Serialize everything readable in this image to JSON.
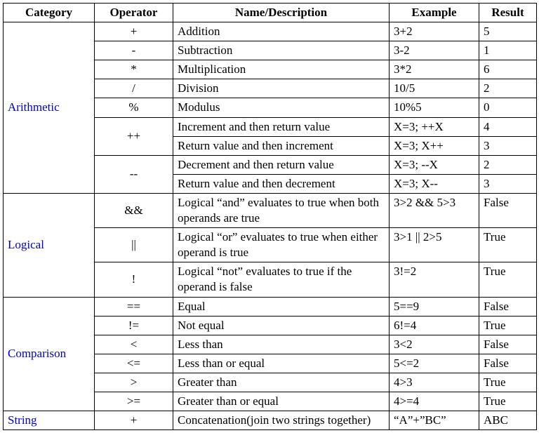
{
  "headers": {
    "category": "Category",
    "operator": "Operator",
    "name": "Name/Description",
    "example": "Example",
    "result": "Result"
  },
  "categories": {
    "arithmetic": "Arithmetic",
    "logical": "Logical",
    "comparison": "Comparison",
    "string": "String"
  },
  "rows": {
    "arith_add": {
      "op": "+",
      "name": "Addition",
      "ex": "3+2",
      "res": "5"
    },
    "arith_sub": {
      "op": "-",
      "name": "Subtraction",
      "ex": "3-2",
      "res": "1"
    },
    "arith_mul": {
      "op": "*",
      "name": "Multiplication",
      "ex": "3*2",
      "res": "6"
    },
    "arith_div": {
      "op": "/",
      "name": "Division",
      "ex": "10/5",
      "res": "2"
    },
    "arith_mod": {
      "op": "%",
      "name": "Modulus",
      "ex": "10%5",
      "res": "0"
    },
    "arith_incpre": {
      "op": "++",
      "name": "Increment and then return value",
      "ex": "X=3; ++X",
      "res": "4"
    },
    "arith_incpost": {
      "name": "Return value and   then increment",
      "ex": "X=3; X++",
      "res": "3"
    },
    "arith_decpre": {
      "op": "--",
      "name": "Decrement and then return value",
      "ex": "X=3; --X",
      "res": "2"
    },
    "arith_decpost": {
      "name": "Return value and   then decrement",
      "ex": "X=3; X--",
      "res": "3"
    },
    "log_and": {
      "op": "&&",
      "name": "Logical “and” evaluates to true when both operands are true",
      "ex": "3>2 && 5>3",
      "res": "False"
    },
    "log_or": {
      "op": "||",
      "name": "Logical “or” evaluates to true when either operand is true",
      "ex": "3>1 || 2>5",
      "res": "True"
    },
    "log_not": {
      "op": "!",
      "name": "Logical “not” evaluates to true if the operand is false",
      "ex": "3!=2",
      "res": "True"
    },
    "cmp_eq": {
      "op": "==",
      "name": "Equal",
      "ex": "5==9",
      "res": "False"
    },
    "cmp_ne": {
      "op": "!=",
      "name": "Not equal",
      "ex": "6!=4",
      "res": "True"
    },
    "cmp_lt": {
      "op": "<",
      "name": "Less than",
      "ex": "3<2",
      "res": "False"
    },
    "cmp_le": {
      "op": "<=",
      "name": "Less than or equal",
      "ex": "5<=2",
      "res": "False"
    },
    "cmp_gt": {
      "op": ">",
      "name": "Greater than",
      "ex": "4>3",
      "res": "True"
    },
    "cmp_ge": {
      "op": ">=",
      "name": "Greater than or equal",
      "ex": "4>=4",
      "res": "True"
    },
    "str_cat": {
      "op": "+",
      "name": "Concatenation(join two strings together)",
      "ex": "“A”+”BC”",
      "res": "ABC"
    }
  }
}
